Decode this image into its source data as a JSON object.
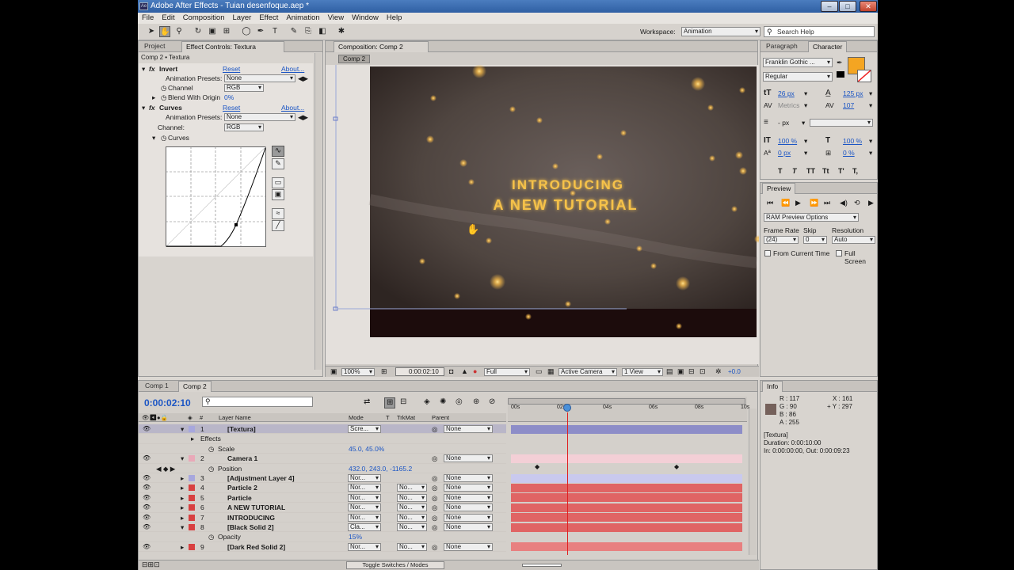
{
  "window": {
    "title": "Adobe After Effects - Tuian desenfoque.aep *",
    "app_icon": "Ae",
    "min": "–",
    "max": "□",
    "close": "✕"
  },
  "menu": [
    "File",
    "Edit",
    "Composition",
    "Layer",
    "Effect",
    "Animation",
    "View",
    "Window",
    "Help"
  ],
  "toolbar": {
    "workspace_label": "Workspace:",
    "workspace_value": "Animation",
    "search_placeholder": "Search Help"
  },
  "effects_panel": {
    "tabs": [
      "Project",
      "Effect Controls: Textura"
    ],
    "breadcrumb": "Comp 2 • Textura",
    "invert": {
      "name": "Invert",
      "reset": "Reset",
      "about": "About...",
      "presets_label": "Animation Presets:",
      "presets_value": "None",
      "channel_label": "Channel",
      "channel_value": "RGB",
      "blend_label": "Blend With Origin",
      "blend_value": "0%"
    },
    "curves": {
      "name": "Curves",
      "reset": "Reset",
      "about": "About...",
      "presets_label": "Animation Presets:",
      "presets_value": "None",
      "channel_label": "Channel:",
      "channel_value": "RGB",
      "curves_label": "Curves"
    }
  },
  "comp_panel": {
    "tab": "Composition: Comp 2",
    "subtab": "Comp 2",
    "title_line1": "INTRODUCING",
    "title_line2": "A NEW TUTORIAL",
    "footer": {
      "zoom": "100%",
      "timecode": "0:00:02:10",
      "resolution": "Full",
      "camera": "Active Camera",
      "views": "1 View",
      "exposure": "+0.0"
    }
  },
  "character": {
    "tabs": [
      "Paragraph",
      "Character"
    ],
    "font": "Franklin Gothic ...",
    "style": "Regular",
    "size": "26 px",
    "leading": "125 px",
    "kerning": "Metrics",
    "tracking": "107",
    "stroke": "- px",
    "vscale": "100 %",
    "hscale": "100 %",
    "baseline": "0 px",
    "tsume": "0 %",
    "fill_color": "#f4a522",
    "style_buttons": [
      "T",
      "T",
      "TT",
      "Tt",
      "T'",
      "T,"
    ]
  },
  "preview": {
    "tab": "Preview",
    "ram": "RAM Preview Options",
    "frame_rate_label": "Frame Rate",
    "skip_label": "Skip",
    "resolution_label": "Resolution",
    "frame_rate": "(24)",
    "skip": "0",
    "resolution": "Auto",
    "from_current": "From Current Time",
    "full_screen": "Full Screen"
  },
  "info": {
    "tab": "Info",
    "r": "R : 117",
    "g": "G : 90",
    "b": "B : 86",
    "a": "A : 255",
    "x": "X : 161",
    "y": "+ Y : 297",
    "swatch": "#75615b",
    "layer": "[Textura]",
    "duration": "Duration: 0:00:10:00",
    "inout": "In: 0:00:00:00, Out: 0:00:09:23"
  },
  "timeline": {
    "tabs": [
      "Comp 1",
      "Comp 2"
    ],
    "timecode": "0:00:02:10",
    "headers": {
      "layer_name": "Layer Name",
      "mode": "Mode",
      "t": "T",
      "trkmat": "TrkMat",
      "parent": "Parent"
    },
    "ruler": [
      "00s",
      "02s",
      "04s",
      "06s",
      "08s",
      "10s"
    ],
    "toggle_label": "Toggle Switches / Modes",
    "rows": [
      {
        "num": "1",
        "name": "[Textura]",
        "mode": "Scre...",
        "parent": "None",
        "color": "#a7a7dd",
        "bar": "#8d8dc8",
        "type": "layer",
        "selected": true,
        "expand": "▾"
      },
      {
        "name": "Effects",
        "type": "group"
      },
      {
        "name": "Scale",
        "value": "45.0, 45.0%",
        "type": "prop"
      },
      {
        "num": "2",
        "name": "Camera 1",
        "parent": "None",
        "color": "#e9a9b8",
        "bar": "#f3cfd6",
        "type": "layer",
        "expand": "▾"
      },
      {
        "name": "Position",
        "value": "432.0, 243.0, -1165.2",
        "type": "prop",
        "keys": true
      },
      {
        "num": "3",
        "name": "[Adjustment Layer 4]",
        "mode": "Nor...",
        "parent": "None",
        "color": "#a7a7dd",
        "bar": "#c9c9ee",
        "type": "layer",
        "expand": "▸"
      },
      {
        "num": "4",
        "name": "Particle 2",
        "mode": "Nor...",
        "trkmat": "No...",
        "parent": "None",
        "color": "#d84040",
        "bar": "#e06464",
        "type": "layer",
        "expand": "▸"
      },
      {
        "num": "5",
        "name": "Particle",
        "mode": "Nor...",
        "trkmat": "No...",
        "parent": "None",
        "color": "#d84040",
        "bar": "#e06464",
        "type": "layer",
        "expand": "▸"
      },
      {
        "num": "6",
        "name": "A NEW TUTORIAL",
        "mode": "Nor...",
        "trkmat": "No...",
        "parent": "None",
        "color": "#d84040",
        "bar": "#e06464",
        "type": "layer",
        "expand": "▸"
      },
      {
        "num": "7",
        "name": "INTRODUCING",
        "mode": "Nor...",
        "trkmat": "No...",
        "parent": "None",
        "color": "#d84040",
        "bar": "#e06464",
        "type": "layer",
        "expand": "▸"
      },
      {
        "num": "8",
        "name": "[Black Solid 2]",
        "mode": "Cla...",
        "trkmat": "No...",
        "parent": "None",
        "color": "#d84040",
        "bar": "#e06464",
        "type": "layer",
        "expand": "▾"
      },
      {
        "name": "Opacity",
        "value": "15%",
        "type": "prop"
      },
      {
        "num": "9",
        "name": "[Dark Red Solid 2]",
        "mode": "Nor...",
        "trkmat": "No...",
        "parent": "None",
        "color": "#d84040",
        "bar": "#e88080",
        "type": "layer",
        "expand": "▸"
      }
    ]
  }
}
